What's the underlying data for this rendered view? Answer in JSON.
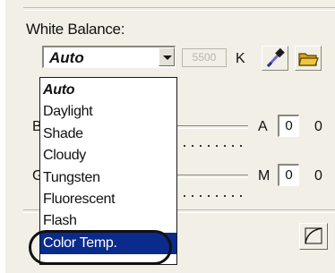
{
  "white_balance": {
    "label": "White Balance:",
    "selected": "Auto",
    "kelvin_value": "5500",
    "kelvin_unit": "K",
    "options": [
      "Auto",
      "Daylight",
      "Shade",
      "Cloudy",
      "Tungsten",
      "Fluorescent",
      "Flash",
      "Color Temp."
    ],
    "highlighted_option": "Color Temp.",
    "icons": {
      "picker": "eyedropper-icon",
      "folder": "folder-icon",
      "curve": "curve-icon"
    }
  },
  "sliders": {
    "row1": {
      "left_letter": "B",
      "right_letter": "A",
      "field_value": "0",
      "value": "0"
    },
    "row2": {
      "left_letter": "G",
      "right_letter": "M",
      "field_value": "0",
      "value": "0"
    }
  },
  "colors": {
    "selection": "#0a2a8c",
    "panel": "#f1efe6"
  }
}
